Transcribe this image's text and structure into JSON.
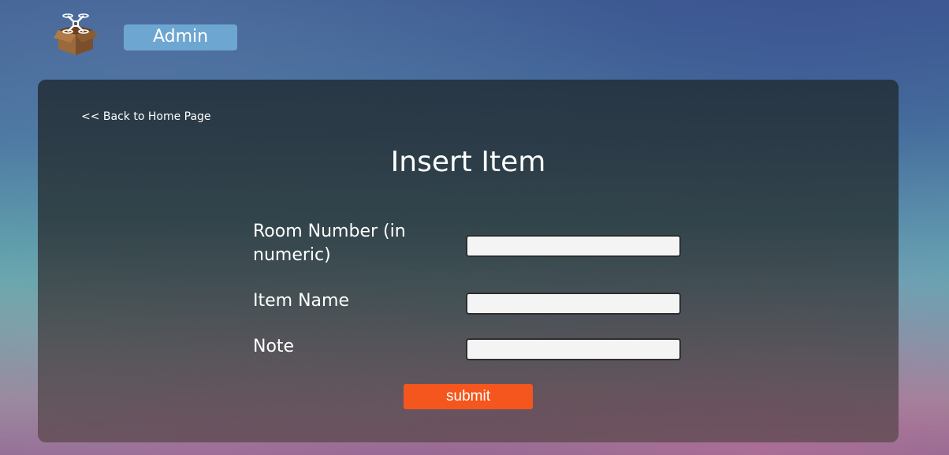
{
  "header": {
    "logo_icon": "drone-box-icon",
    "admin_label": "Admin",
    "admin_color": "#6ea6d2"
  },
  "form": {
    "back_link": "<< Back to Home Page",
    "title": "Insert Item",
    "fields": [
      {
        "label": "Room Number (in numeric)",
        "value": "",
        "placeholder": ""
      },
      {
        "label": "Item Name",
        "value": "",
        "placeholder": ""
      },
      {
        "label": "Note",
        "value": "",
        "placeholder": ""
      }
    ],
    "submit_label": "submit",
    "submit_color": "#f5561d"
  }
}
